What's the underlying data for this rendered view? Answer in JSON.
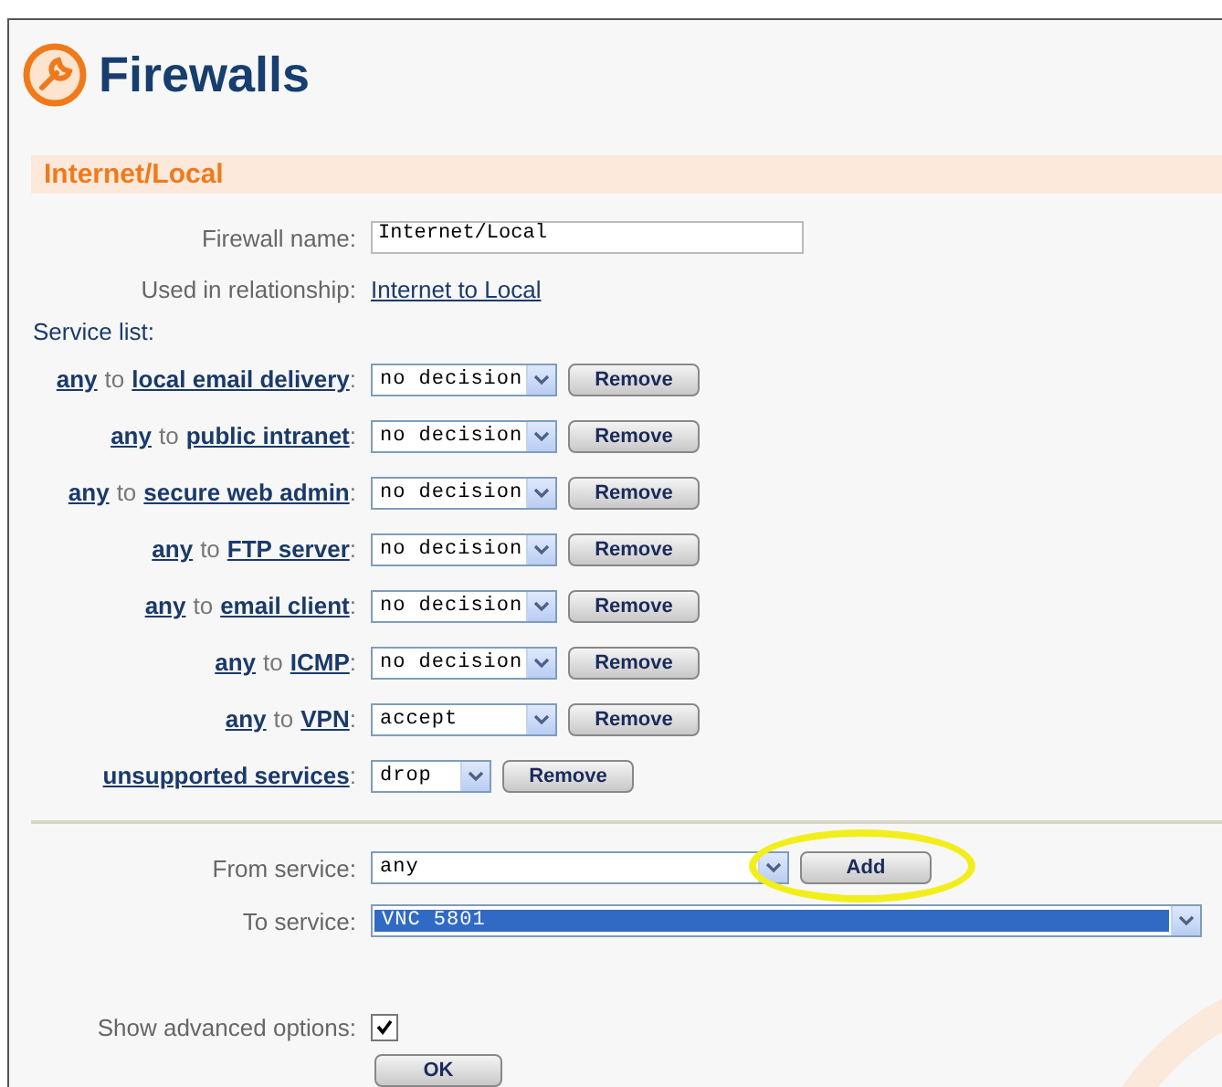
{
  "page": {
    "title": "Firewalls"
  },
  "section": {
    "title": "Internet/Local"
  },
  "firewall_name": {
    "label": "Firewall name:",
    "value": "Internet/Local"
  },
  "relationship": {
    "label": "Used in relationship:",
    "link": "Internet to Local"
  },
  "service_list": {
    "label": "Service list:",
    "rows": [
      {
        "kind": "pair",
        "from": "any",
        "joiner": "to",
        "to": "local email delivery",
        "suffix": ":",
        "decision": "no decision",
        "button": "Remove"
      },
      {
        "kind": "pair",
        "from": "any",
        "joiner": "to",
        "to": "public intranet",
        "suffix": ":",
        "decision": "no decision",
        "button": "Remove"
      },
      {
        "kind": "pair",
        "from": "any",
        "joiner": "to",
        "to": "secure web admin",
        "suffix": ":",
        "decision": "no decision",
        "button": "Remove"
      },
      {
        "kind": "pair",
        "from": "any",
        "joiner": "to",
        "to": "FTP server",
        "suffix": ":",
        "decision": "no decision",
        "button": "Remove"
      },
      {
        "kind": "pair",
        "from": "any",
        "joiner": "to",
        "to": "email client",
        "suffix": ":",
        "decision": "no decision",
        "button": "Remove"
      },
      {
        "kind": "pair",
        "from": "any",
        "joiner": "to",
        "to": "ICMP",
        "suffix": ":",
        "decision": "no decision",
        "button": "Remove"
      },
      {
        "kind": "pair",
        "from": "any",
        "joiner": "to",
        "to": "VPN",
        "suffix": ":",
        "decision": "accept",
        "button": "Remove"
      },
      {
        "kind": "single",
        "to": "unsupported services",
        "suffix": ":",
        "decision": "drop",
        "button": "Remove"
      }
    ]
  },
  "from_service": {
    "label": "From service:",
    "value": "any",
    "button": "Add"
  },
  "to_service": {
    "label": "To service:",
    "value": "VNC 5801",
    "selected": true
  },
  "advanced": {
    "label": "Show advanced options:",
    "checked": true
  },
  "ok_button": "OK"
}
